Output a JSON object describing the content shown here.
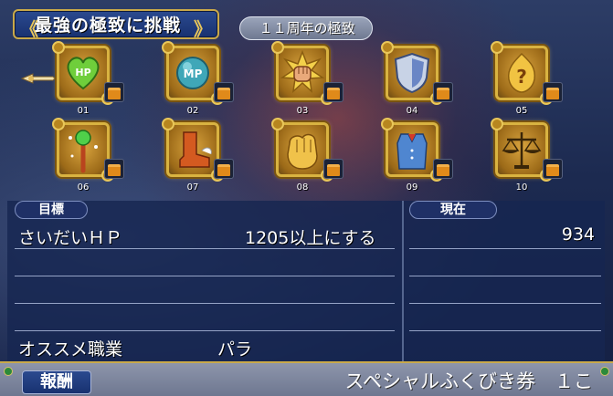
{
  "header": {
    "title": "最強の極致に挑戦",
    "tab_label": "１１周年の極致"
  },
  "challenges": [
    {
      "number": "01",
      "icon": "hp-heart-icon"
    },
    {
      "number": "02",
      "icon": "mp-orb-icon"
    },
    {
      "number": "03",
      "icon": "fist-burst-icon"
    },
    {
      "number": "04",
      "icon": "shield-icon"
    },
    {
      "number": "05",
      "icon": "flame-question-icon"
    },
    {
      "number": "06",
      "icon": "magic-staff-icon"
    },
    {
      "number": "07",
      "icon": "boot-icon"
    },
    {
      "number": "08",
      "icon": "glove-icon"
    },
    {
      "number": "09",
      "icon": "vest-icon"
    },
    {
      "number": "10",
      "icon": "scales-icon"
    }
  ],
  "goal": {
    "target_header": "目標",
    "current_header": "現在",
    "stat_name": "さいだいＨＰ",
    "stat_requirement": "1205以上にする",
    "current_value": "934",
    "recommended_label": "オススメ職業",
    "recommended_job": "パラ"
  },
  "reward": {
    "label": "報酬",
    "item": "スペシャルふくびき券　１こ"
  },
  "colors": {
    "gold_frame": "#d9b341",
    "panel_blue": "#183170",
    "reward_bar": "#7d869e"
  }
}
